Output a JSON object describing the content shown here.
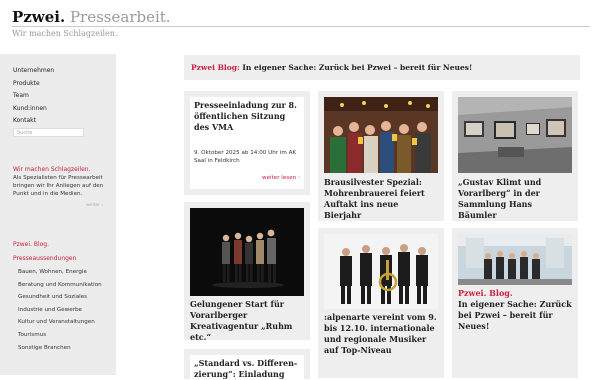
{
  "header": {
    "brand_bold": "Pzwei.",
    "brand_light": "Presse­arbeit.",
    "tagline": "Wir machen Schlagzeilen."
  },
  "sidebar": {
    "nav": [
      "Unternehmen",
      "Produkte",
      "Team",
      "Kund:innen",
      "Kontakt"
    ],
    "search_placeholder": "Suche",
    "sub_title": "Wir machen Schlagzeilen.",
    "sub_text": "Als Spezialisten für Presse­arbeit bringen wir Ihr Anliegen auf den Punkt und in die Medien.",
    "more_small": "weiter ›",
    "blog": "Pzwei. Blog.",
    "press": "Presse­aussendungen",
    "categories": [
      "Bauen, Wohnen, Energie",
      "Beratung und Kommunikation",
      "Gesundheit und Soziales",
      "Industrie und Gewerbe",
      "Kultur und Veranstaltungen",
      "Tourismus",
      "Sonstige Branchen"
    ]
  },
  "banner": {
    "label": "Pzwei Blog:",
    "text": " In eigener Sache: Zurück bei Pzwei – bereit für Neues!"
  },
  "cards": {
    "c1": {
      "title": "Presse­einladung zur 8. öffentlichen Sitzung des VMA",
      "desc": "9. Oktober 2025 ab 14:00 Uhr im AK Saal in Feldkirch",
      "more": "weiter lesen",
      "more_arrow": "›"
    },
    "c2": {
      "title": "Gelungener Start für Vor­arlberger Kreativagentur „Ruhm etc.“"
    },
    "c3": {
      "title": "„Standard vs. Differen­zierung“: Einladung"
    },
    "c4": {
      "title": "Brausilvester Spezial: Mohrenbrauerei feiert Auftakt ins neue Bierjahr"
    },
    "c5": {
      "title": ":alpenarte vereint vom 9. bis 12.10. internationale und regionale Musiker auf Top-Niveau"
    },
    "c6": {
      "title": "„Gustav Klimt und Vorarl­berg“ in der Sammlung Hans Bäumler"
    },
    "c7": {
      "kicker": "Pzwei. Blog.",
      "title": "In eigener Sache: Zurück bei Pzwei – bereit für Neues!"
    }
  },
  "colors": {
    "accent": "#c8203e",
    "panel": "#eeeeee",
    "sidebar": "#ececec"
  }
}
